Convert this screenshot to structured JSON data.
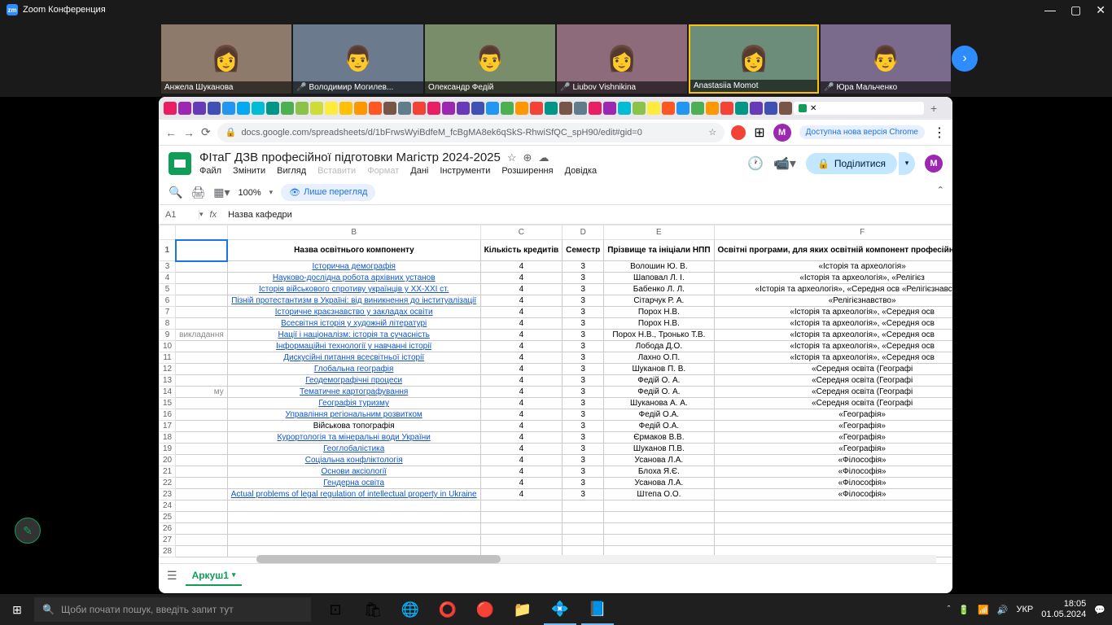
{
  "zoom": {
    "title": "Zoom Конференция",
    "participants": [
      {
        "name": "Анжела Шуканова",
        "muted": false
      },
      {
        "name": "Володимир Могилев...",
        "muted": true
      },
      {
        "name": "Олександр Федій",
        "muted": false
      },
      {
        "name": "Liubov Vishnikina",
        "muted": true
      },
      {
        "name": "Anastasiia Momot",
        "muted": false
      },
      {
        "name": "Юра Мальченко",
        "muted": true
      }
    ]
  },
  "browser": {
    "url": "docs.google.com/spreadsheets/d/1bFrwsWyiBdfeM_fcBgMA8ek6qSkS-RhwiSfQC_spH90/edit#gid=0",
    "update_badge": "Доступна нова версія Chrome"
  },
  "sheets": {
    "doc_title": "ФІтаГ ДЗВ професійної підготовки Магістр 2024-2025",
    "menu": [
      "Файл",
      "Змінити",
      "Вигляд",
      "Вставити",
      "Формат",
      "Дані",
      "Інструменти",
      "Розширення",
      "Довідка"
    ],
    "menu_disabled": [
      3,
      4
    ],
    "zoom": "100%",
    "view_mode": "Лише перегляд",
    "share": "Поділитися",
    "avatar": "M",
    "cell_ref": "A1",
    "formula": "Назва кафедри",
    "sheet_tab": "Аркуш1",
    "col_letters": [
      "",
      "B",
      "C",
      "D",
      "E",
      "F"
    ],
    "header": {
      "b": "Назва освітнього компоненту",
      "c": "Кількість кредитів",
      "d": "Семестр",
      "e": "Прізвище та ініціали НПП",
      "f": "Освітні програми, для яких освітній компонент професійної підготовки"
    },
    "a_fragments": {
      "9": "викладання",
      "14": "му"
    },
    "rows": [
      {
        "n": 3,
        "b": "Історична демографія",
        "c": "4",
        "d": "3",
        "e": "Волошин Ю. В.",
        "f": "«Історія та археологія»",
        "link": true
      },
      {
        "n": 4,
        "b": "Науково-дослідна робота архівних установ",
        "c": "4",
        "d": "3",
        "e": "Шаповал Л. І.",
        "f": "«Історія та археологія», «Релігієз",
        "link": true
      },
      {
        "n": 5,
        "b": "Історія військового спротиву українців у XX-XXI ст.",
        "c": "4",
        "d": "3",
        "e": "Бабенко Л. Л.",
        "f": "«Історія та археологія», «Середня осв «Релігієзнавство»",
        "link": true
      },
      {
        "n": 6,
        "b": "Пізній протестантизм в Україні: від виникнення до інституалізації",
        "c": "4",
        "d": "3",
        "e": "Сітарчук Р. А.",
        "f": "«Релігієзнавство»",
        "link": true
      },
      {
        "n": 7,
        "b": "Історичне краєзнавство у закладах освіти",
        "c": "4",
        "d": "3",
        "e": "Порох Н.В.",
        "f": "«Історія та археологія», «Середня осв",
        "link": true
      },
      {
        "n": 8,
        "b": "Всесвітня історія у художній літературі",
        "c": "4",
        "d": "3",
        "e": "Порох Н.В.",
        "f": "«Історія та археологія», «Середня осв",
        "link": true
      },
      {
        "n": 9,
        "b": "Нації і націоналізм: історія та сучасність",
        "c": "4",
        "d": "3",
        "e": "Порох Н.В., Тронько Т.В.",
        "f": "«Історія та археологія», «Середня осв",
        "link": true
      },
      {
        "n": 10,
        "b": "Інформаційні технології у навчанні історії",
        "c": "4",
        "d": "3",
        "e": "Лобода Д.О.",
        "f": "«Історія та археологія», «Середня осв",
        "link": true
      },
      {
        "n": 11,
        "b": "Дискусійні питання всесвітньої історії",
        "c": "4",
        "d": "3",
        "e": "Лахно О.П.",
        "f": "«Історія та археологія», «Середня осв",
        "link": true
      },
      {
        "n": 12,
        "b": "Глобальна географія",
        "c": "4",
        "d": "3",
        "e": "Шуканов П. В.",
        "f": "«Середня освіта (Географі",
        "link": true
      },
      {
        "n": 13,
        "b": "Геодемографічні процеси",
        "c": "4",
        "d": "3",
        "e": "Федій О. А.",
        "f": "«Середня освіта (Географі",
        "link": true
      },
      {
        "n": 14,
        "b": "Тематичне картографування",
        "c": "4",
        "d": "3",
        "e": "Федій О. А.",
        "f": "«Середня освіта (Географі",
        "link": true
      },
      {
        "n": 15,
        "b": "Географія туризму",
        "c": "4",
        "d": "3",
        "e": "Шуканова А. А.",
        "f": "«Середня освіта (Географі",
        "link": true
      },
      {
        "n": 16,
        "b": "Управління регіональним розвитком",
        "c": "4",
        "d": "3",
        "e": "Федій О.А.",
        "f": "«Географія»",
        "link": true
      },
      {
        "n": 17,
        "b": "Військова топографія",
        "c": "4",
        "d": "3",
        "e": "Федій О.А.",
        "f": "«Географія»",
        "link": false
      },
      {
        "n": 18,
        "b": "Курортологія та мінеральні води України",
        "c": "4",
        "d": "3",
        "e": "Єрмаков В.В.",
        "f": "«Географія»",
        "link": true
      },
      {
        "n": 19,
        "b": "Геоглобалістика",
        "c": "4",
        "d": "3",
        "e": "Шуканов П.В.",
        "f": "«Географія»",
        "link": true
      },
      {
        "n": 20,
        "b": "Соціальна конфліктологія",
        "c": "4",
        "d": "3",
        "e": "Усанова Л.А.",
        "f": "«Філософія»",
        "link": true
      },
      {
        "n": 21,
        "b": "Основи аксіології",
        "c": "4",
        "d": "3",
        "e": "Блоха Я.Є.",
        "f": "«Філософія»",
        "link": true
      },
      {
        "n": 22,
        "b": "Гендерна освіта",
        "c": "4",
        "d": "3",
        "e": "Усанова Л.А.",
        "f": "«Філософія»",
        "link": true
      },
      {
        "n": 23,
        "b": "Actual problems of legal regulation of intellectual property in Ukraine",
        "c": "4",
        "d": "3",
        "e": "Штепа О.О.",
        "f": "«Філософія»",
        "link": true
      },
      {
        "n": 24,
        "b": "",
        "c": "",
        "d": "",
        "e": "",
        "f": "",
        "link": false
      },
      {
        "n": 25,
        "b": "",
        "c": "",
        "d": "",
        "e": "",
        "f": "",
        "link": false
      },
      {
        "n": 26,
        "b": "",
        "c": "",
        "d": "",
        "e": "",
        "f": "",
        "link": false
      },
      {
        "n": 27,
        "b": "",
        "c": "",
        "d": "",
        "e": "",
        "f": "",
        "link": false
      },
      {
        "n": 28,
        "b": "",
        "c": "",
        "d": "",
        "e": "",
        "f": "",
        "link": false
      }
    ]
  },
  "taskbar": {
    "search_placeholder": "Щоби почати пошук, введіть запит тут",
    "lang": "УКР",
    "time": "18:05",
    "date": "01.05.2024"
  }
}
